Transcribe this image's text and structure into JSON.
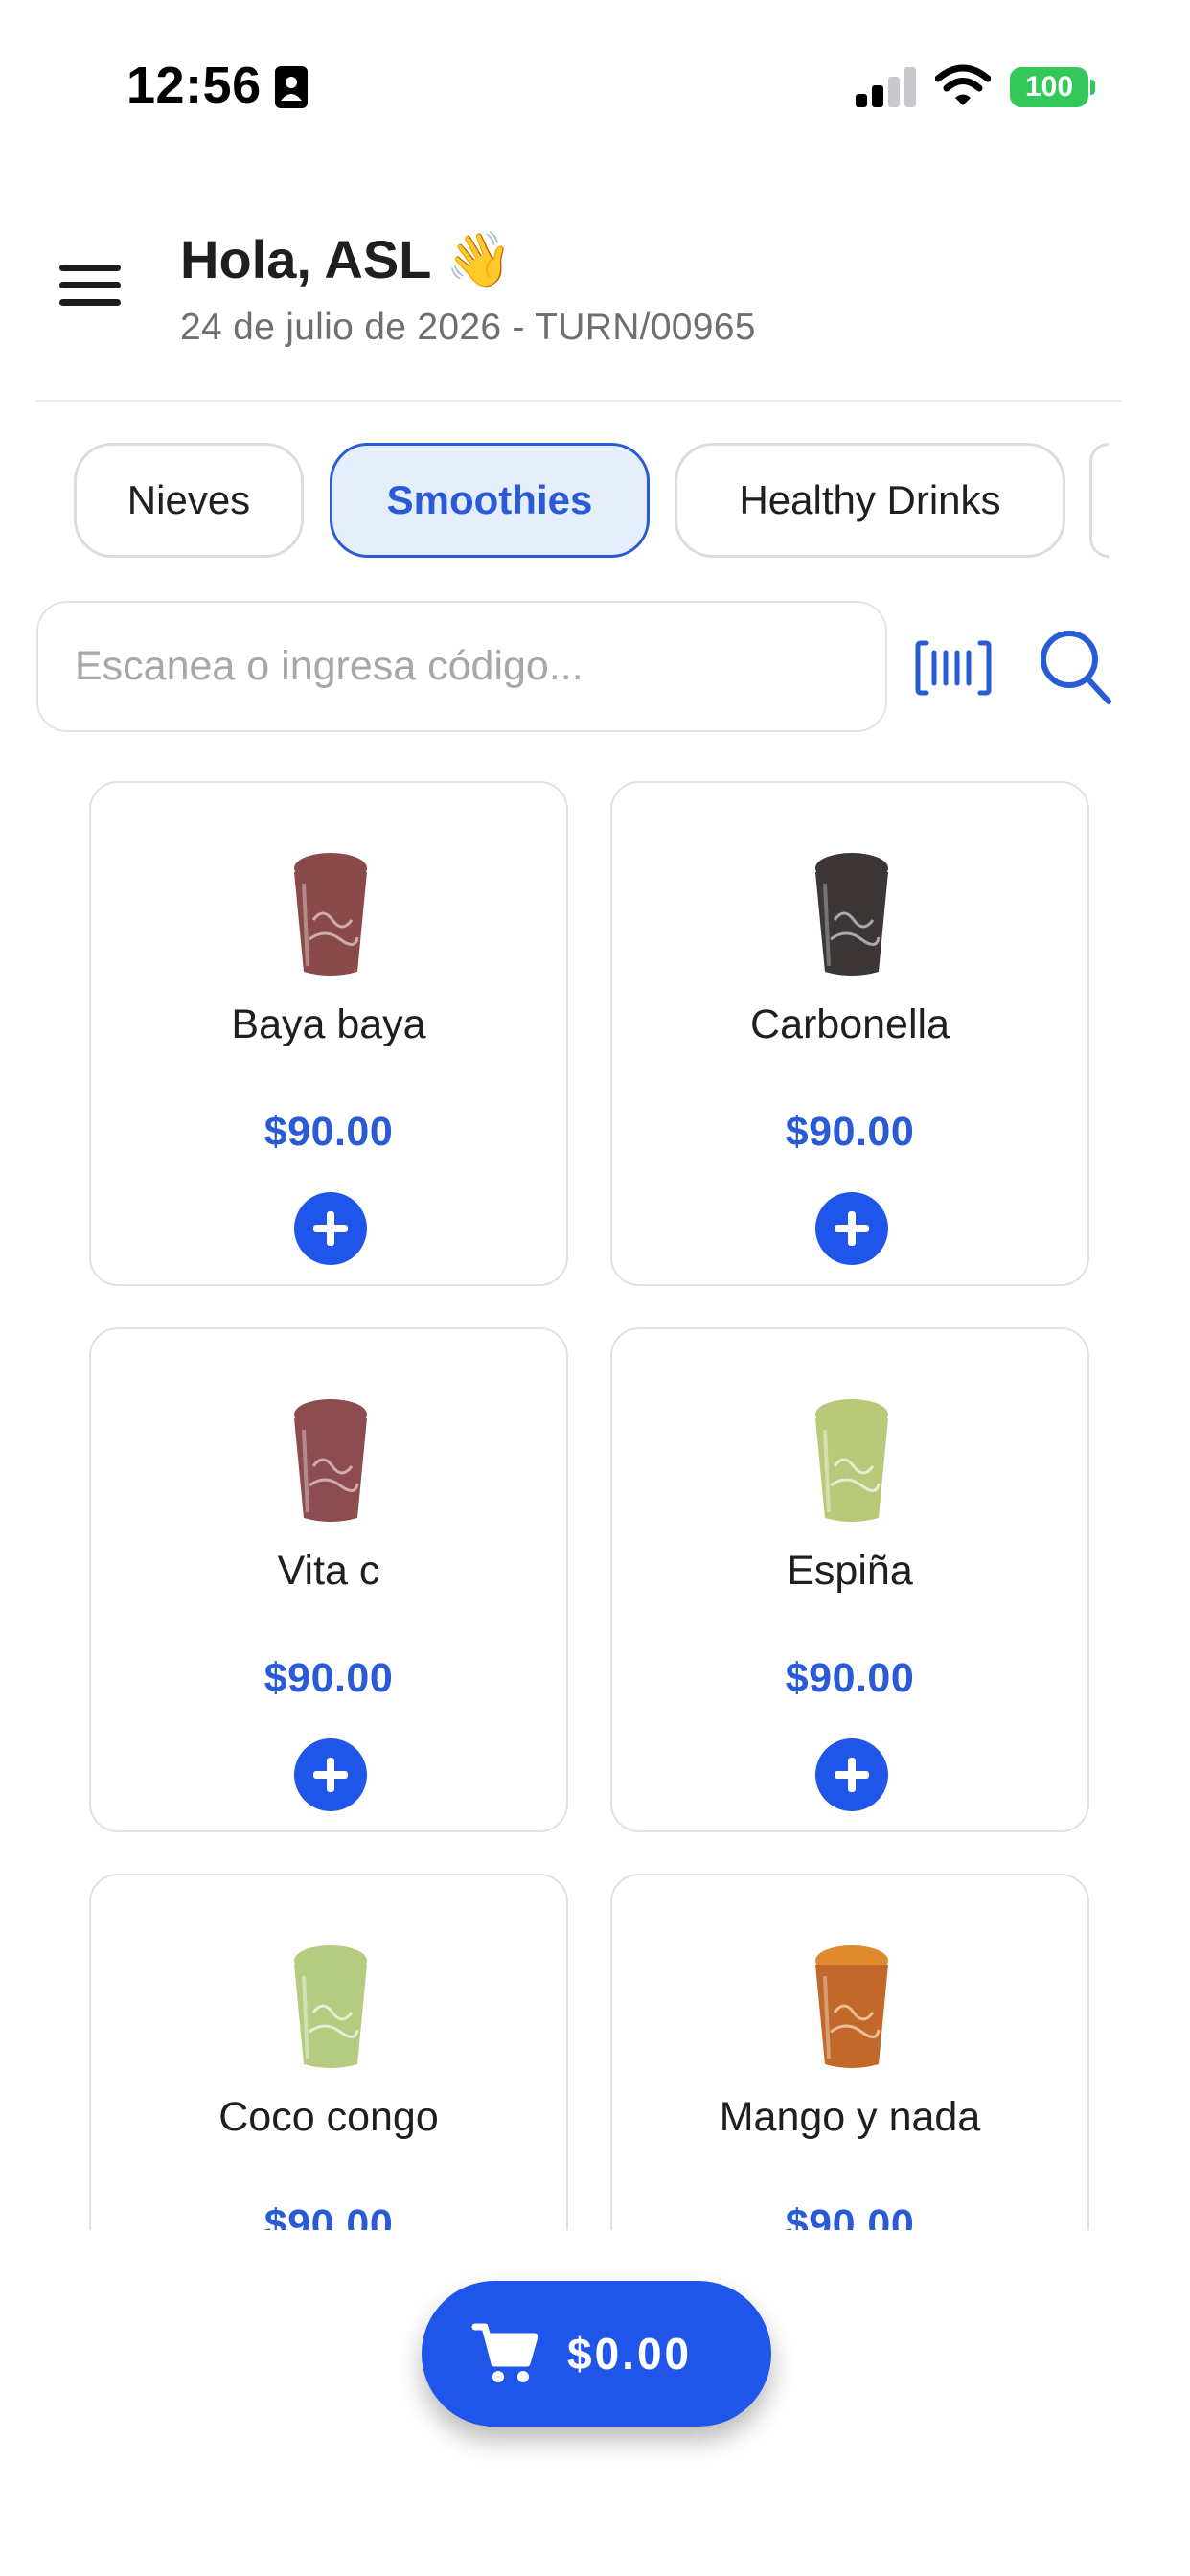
{
  "status_bar": {
    "time": "12:56",
    "battery": "100"
  },
  "header": {
    "greeting": "Hola, ASL",
    "greeting_emoji": "👋",
    "subtitle": "24 de julio de 2026 - TURN/00965"
  },
  "tabs": [
    {
      "label": "Nieves",
      "active": false
    },
    {
      "label": "Smoothies",
      "active": true
    },
    {
      "label": "Healthy Drinks",
      "active": false
    }
  ],
  "search": {
    "placeholder": "Escanea o ingresa código...",
    "value": ""
  },
  "products": [
    {
      "name": "Baya baya",
      "price": "$90.00",
      "color": "#8a4a4a"
    },
    {
      "name": "Carbonella",
      "price": "$90.00",
      "color": "#3c3636"
    },
    {
      "name": "Vita c",
      "price": "$90.00",
      "color": "#8d4c50"
    },
    {
      "name": "Espiña",
      "price": "$90.00",
      "color": "#b8c97a"
    },
    {
      "name": "Coco congo",
      "price": "$90.00",
      "color": "#b5cc80"
    },
    {
      "name": "Mango y nada",
      "price": "$90.00",
      "color": "#c2682a"
    }
  ],
  "cart": {
    "total": "$0.00"
  },
  "colors": {
    "accent": "#1f55e8",
    "price": "#2a5bd7",
    "active_tab_bg": "#e6eefc",
    "battery": "#34c759"
  },
  "icons": {
    "menu": "menu-icon",
    "barcode": "barcode-icon",
    "search": "search-icon",
    "add": "plus-icon",
    "cart": "cart-icon"
  }
}
